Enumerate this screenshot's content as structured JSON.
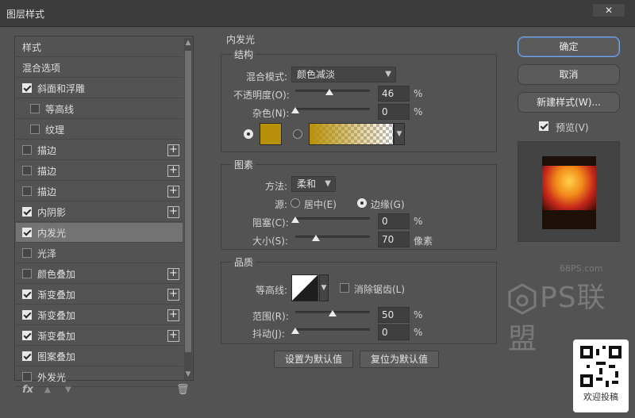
{
  "window": {
    "title": "图层样式",
    "close_glyph": "✕"
  },
  "style_list": {
    "items": [
      {
        "label": "样式",
        "checkbox": false,
        "checked": false,
        "indent": false,
        "plus": false,
        "selected": false
      },
      {
        "label": "混合选项",
        "checkbox": false,
        "checked": false,
        "indent": false,
        "plus": false,
        "selected": false
      },
      {
        "label": "斜面和浮雕",
        "checkbox": true,
        "checked": true,
        "indent": false,
        "plus": false,
        "selected": false
      },
      {
        "label": "等高线",
        "checkbox": true,
        "checked": false,
        "indent": true,
        "plus": false,
        "selected": false
      },
      {
        "label": "纹理",
        "checkbox": true,
        "checked": false,
        "indent": true,
        "plus": false,
        "selected": false
      },
      {
        "label": "描边",
        "checkbox": true,
        "checked": false,
        "indent": false,
        "plus": true,
        "selected": false
      },
      {
        "label": "描边",
        "checkbox": true,
        "checked": false,
        "indent": false,
        "plus": true,
        "selected": false
      },
      {
        "label": "描边",
        "checkbox": true,
        "checked": false,
        "indent": false,
        "plus": true,
        "selected": false
      },
      {
        "label": "内阴影",
        "checkbox": true,
        "checked": true,
        "indent": false,
        "plus": true,
        "selected": false
      },
      {
        "label": "内发光",
        "checkbox": true,
        "checked": true,
        "indent": false,
        "plus": false,
        "selected": true
      },
      {
        "label": "光泽",
        "checkbox": true,
        "checked": false,
        "indent": false,
        "plus": false,
        "selected": false
      },
      {
        "label": "颜色叠加",
        "checkbox": true,
        "checked": false,
        "indent": false,
        "plus": true,
        "selected": false
      },
      {
        "label": "渐变叠加",
        "checkbox": true,
        "checked": true,
        "indent": false,
        "plus": true,
        "selected": false
      },
      {
        "label": "渐变叠加",
        "checkbox": true,
        "checked": true,
        "indent": false,
        "plus": true,
        "selected": false
      },
      {
        "label": "渐变叠加",
        "checkbox": true,
        "checked": true,
        "indent": false,
        "plus": true,
        "selected": false
      },
      {
        "label": "图案叠加",
        "checkbox": true,
        "checked": true,
        "indent": false,
        "plus": false,
        "selected": false
      },
      {
        "label": "外发光",
        "checkbox": true,
        "checked": false,
        "indent": false,
        "plus": false,
        "selected": false
      }
    ],
    "plus_glyph": "+",
    "bottom": {
      "fx": "fx",
      "up": "▲",
      "down": "▼",
      "trash": "🗑"
    }
  },
  "inner_glow": {
    "title": "内发光",
    "structure": {
      "title": "结构",
      "blend_label": "混合模式:",
      "blend_value": "颜色减淡",
      "opacity_label": "不透明度(O):",
      "opacity_value": "46",
      "opacity_fraction": 0.46,
      "noise_label": "杂色(N):",
      "noise_value": "0",
      "noise_fraction": 0.0,
      "percent": "%",
      "color": "#b8900a"
    },
    "elements": {
      "title": "图素",
      "method_label": "方法:",
      "method_value": "柔和",
      "source_label": "源:",
      "center_label": "居中(E)",
      "edge_label": "边缘(G)",
      "choke_label": "阻塞(C):",
      "choke_value": "0",
      "choke_fraction": 0.0,
      "size_label": "大小(S):",
      "size_value": "70",
      "size_fraction": 0.28,
      "size_unit": "像素",
      "percent": "%"
    },
    "quality": {
      "title": "品质",
      "contour_label": "等高线:",
      "antialias_label": "消除锯齿(L)",
      "range_label": "范围(R):",
      "range_value": "50",
      "range_fraction": 0.5,
      "jitter_label": "抖动(J):",
      "jitter_value": "0",
      "jitter_fraction": 0.0,
      "percent": "%"
    },
    "set_default": "设置为默认值",
    "reset_default": "复位为默认值"
  },
  "actions": {
    "ok": "确定",
    "cancel": "取消",
    "new_style": "新建样式(W)...",
    "preview_label": "预览(V)"
  },
  "watermark": {
    "sub": "68PS.com",
    "main": "PS联盟"
  },
  "qr": {
    "caption": "欢迎投稿"
  }
}
